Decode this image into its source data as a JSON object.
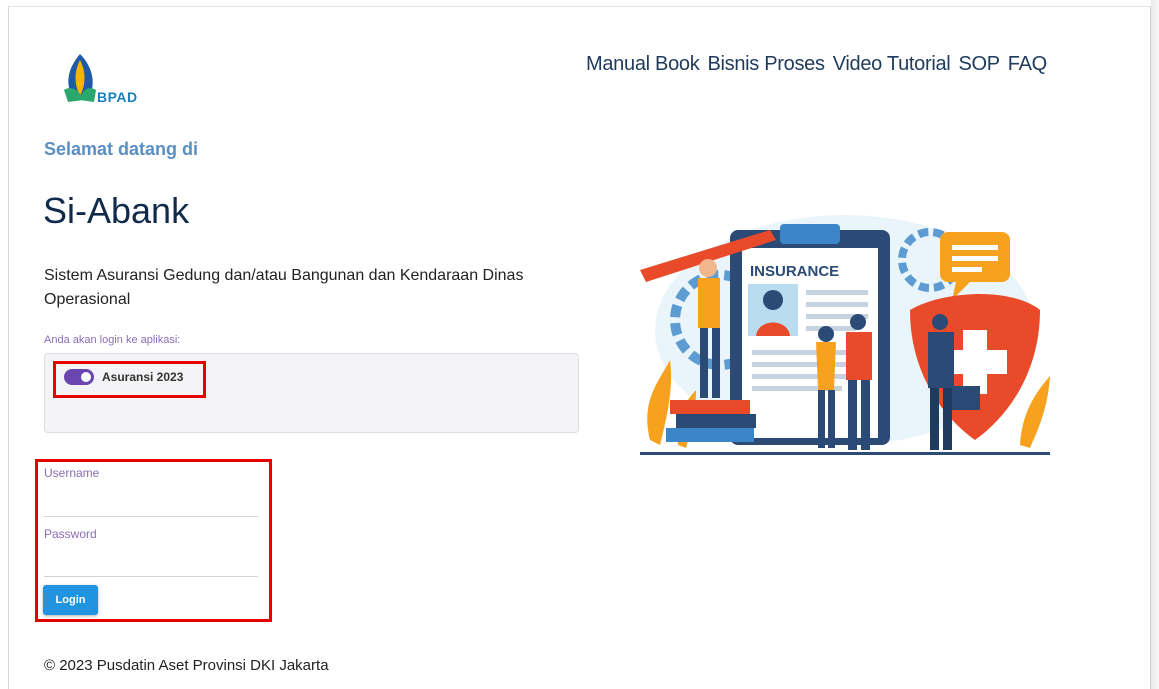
{
  "header": {
    "logo_text": "BPAD",
    "nav": [
      "Manual Book",
      "Bisnis Proses",
      "Video Tutorial",
      "SOP",
      "FAQ"
    ]
  },
  "hero": {
    "welcome": "Selamat datang di",
    "app_name": "Si-Abank",
    "description": "Sistem Asuransi Gedung dan/atau Bangunan dan Kendaraan Dinas Operasional"
  },
  "app_select": {
    "note": "Anda akan login ke aplikasi:",
    "toggle_label": "Asuransi 2023",
    "toggle_on": true
  },
  "form": {
    "username_label": "Username",
    "username_value": "",
    "password_label": "Password",
    "password_value": "",
    "login_label": "Login"
  },
  "illustration": {
    "badge_text": "INSURANCE"
  },
  "footer": {
    "text": "© 2023 Pusdatin Aset Provinsi DKI Jakarta"
  },
  "colors": {
    "accent": "#6a47b0",
    "button": "#2194e0",
    "highlight": "#e60000",
    "title": "#102a4c"
  }
}
